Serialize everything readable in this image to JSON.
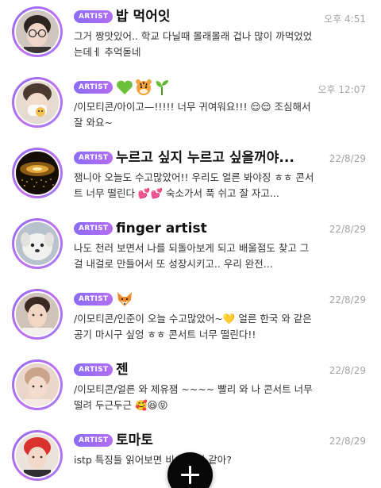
{
  "chats": [
    {
      "badge": "ARTIST",
      "name": "밥 먹어잇",
      "time": "오후 4:51",
      "message": "그거 짱맛있어.. 학교 다닐때 몰래몰래 겁나 많이 까먹었었는데ㅔ 추억돋네",
      "avatar_icon": "glasses-portrait"
    },
    {
      "badge": "ARTIST",
      "name_icons": [
        "green-heart-icon",
        "tiger-icon",
        "seedling-icon"
      ],
      "time": "오후 12:07",
      "message": "/이모티콘/아이고—!!!!! 너무 귀여워요!!! 😌😌 조심해서 잘 와요~",
      "avatar_icon": "masked-portrait"
    },
    {
      "badge": "ARTIST",
      "name": "누르고 싶지 누르고 싶을꺼야...",
      "time": "22/8/29",
      "message": "잼니아 오늘도 수고많았어!! 우리도 얼른 봐야징 ㅎㅎ 콘서트 너무 떨린다 💕💕 숙소가서 푹 쉬고 잘 자고...",
      "avatar_icon": "concert-stage"
    },
    {
      "badge": "ARTIST",
      "name": "finger artist",
      "time": "22/8/29",
      "message": "나도 천러 보면서 나를 되돌아보게 되고 배울점도 찾고 그걸 내걸로 만들어서 또 성장시키고.. 우리 완전...",
      "avatar_icon": "puppy"
    },
    {
      "badge": "ARTIST",
      "name_icons": [
        "fox-icon"
      ],
      "time": "22/8/29",
      "message": "/이모티콘/인준이 오늘 수고많았어~💛 얼른 한국 와 같은 공기 마시구 싶엉 ㅎㅎ 콘서트 너무 떨린다!!",
      "avatar_icon": "portrait"
    },
    {
      "badge": "ARTIST",
      "name": "젠",
      "time": "22/8/29",
      "message": "/이모티콘/얼른 와 제유잼 ~~~~ 빨리 와 나 콘서트 너무 떨려 두근두근 🥰😆😝",
      "avatar_icon": "portrait"
    },
    {
      "badge": "ARTIST",
      "name": "토마토",
      "time": "22/8/29",
      "message": "istp 특징들 읽어보면            비슷한 것 같아?",
      "avatar_icon": "red-hair-portrait"
    }
  ],
  "colors": {
    "badge": "#9b6df5",
    "ring": "#b36ff2",
    "time": "#a3a3a3",
    "fab": "#070707"
  },
  "fab_icon": "plus-icon"
}
